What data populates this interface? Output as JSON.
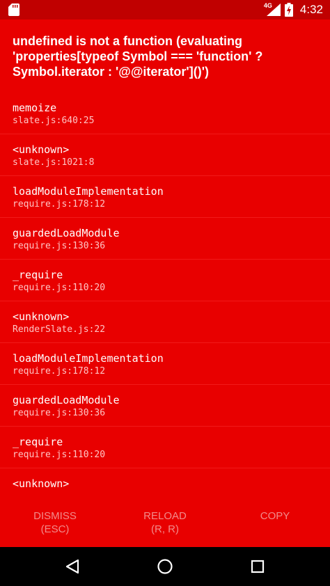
{
  "status_bar": {
    "network": "4G",
    "time": "4:32"
  },
  "error": {
    "message": "undefined is not a function (evaluating 'properties[typeof Symbol === 'function' ? Symbol.iterator : '@@iterator']()')"
  },
  "stack": [
    {
      "method": "memoize",
      "location": "slate.js:640:25"
    },
    {
      "method": "<unknown>",
      "location": "slate.js:1021:8"
    },
    {
      "method": "loadModuleImplementation",
      "location": "require.js:178:12"
    },
    {
      "method": "guardedLoadModule",
      "location": "require.js:130:36"
    },
    {
      "method": "_require",
      "location": "require.js:110:20"
    },
    {
      "method": "<unknown>",
      "location": "RenderSlate.js:22"
    },
    {
      "method": "loadModuleImplementation",
      "location": "require.js:178:12"
    },
    {
      "method": "guardedLoadModule",
      "location": "require.js:130:36"
    },
    {
      "method": "_require",
      "location": "require.js:110:20"
    },
    {
      "method": "<unknown>",
      "location": ""
    }
  ],
  "buttons": {
    "dismiss": {
      "label": "Dismiss",
      "shortcut": "(ESC)"
    },
    "reload": {
      "label": "Reload",
      "shortcut": "(R, R)"
    },
    "copy": {
      "label": "Copy"
    }
  },
  "colors": {
    "background": "#e80000",
    "status_bar": "#c00000",
    "button_text": "#f28b8b"
  },
  "icons": {
    "sd_card": "sd-card-icon",
    "signal": "signal-icon",
    "battery": "battery-charging-icon",
    "back": "back-icon",
    "home": "home-icon",
    "recents": "recents-icon"
  }
}
